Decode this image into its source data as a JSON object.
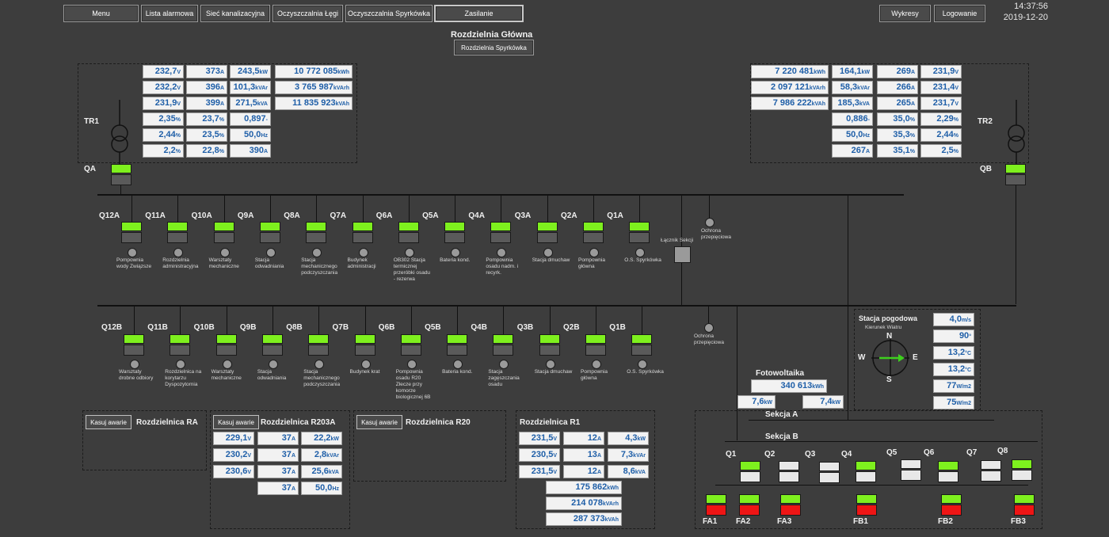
{
  "nav": {
    "menu": "Menu",
    "alarms": "Lista alarmowa",
    "sewer": "Sieć kanalizacyjna",
    "legi": "Oczyszczalnia Łęgi",
    "spyrkowka": "Oczyszczalnia Spyrkówka",
    "zasilanie": "Zasilanie",
    "wykresy": "Wykresy",
    "logowanie": "Logowanie"
  },
  "clock": {
    "time": "14:37:56",
    "date": "2019-12-20"
  },
  "page": {
    "title": "Rozdzielnia Główna",
    "subtitle_button": "Rozdzielnia Spyrkówka"
  },
  "tr1": {
    "label": "TR1",
    "breaker": "QA",
    "values": [
      [
        "232,7",
        "V"
      ],
      [
        "373",
        "A"
      ],
      [
        "243,5",
        "kW"
      ],
      [
        "10 772 085",
        "kWh"
      ],
      [
        "232,2",
        "V"
      ],
      [
        "396",
        "A"
      ],
      [
        "101,3",
        "kVAr"
      ],
      [
        "3 765 987",
        "kVArh"
      ],
      [
        "231,9",
        "V"
      ],
      [
        "399",
        "A"
      ],
      [
        "271,5",
        "kVA"
      ],
      [
        "11 835 923",
        "kVAh"
      ],
      [
        "2,35",
        "%"
      ],
      [
        "23,7",
        "%"
      ],
      [
        "0,897",
        "-"
      ],
      [
        "2,44",
        "%"
      ],
      [
        "23,5",
        "%"
      ],
      [
        "50,0",
        "Hz"
      ],
      [
        "2,2",
        "%"
      ],
      [
        "22,8",
        "%"
      ],
      [
        "390",
        "A"
      ]
    ]
  },
  "tr2": {
    "label": "TR2",
    "breaker": "QB",
    "values": [
      [
        "7 220 481",
        "kWh"
      ],
      [
        "164,1",
        "kW"
      ],
      [
        "269",
        "A"
      ],
      [
        "231,9",
        "V"
      ],
      [
        "2 097 121",
        "kVArh"
      ],
      [
        "58,3",
        "kVAr"
      ],
      [
        "266",
        "A"
      ],
      [
        "231,4",
        "V"
      ],
      [
        "7 986 222",
        "kVAh"
      ],
      [
        "185,3",
        "kVA"
      ],
      [
        "265",
        "A"
      ],
      [
        "231,7",
        "V"
      ],
      [
        "0,886",
        "-"
      ],
      [
        "35,0",
        "%"
      ],
      [
        "2,29",
        "%"
      ],
      [
        "50,0",
        "Hz"
      ],
      [
        "35,3",
        "%"
      ],
      [
        "2,44",
        "%"
      ],
      [
        "267",
        "A"
      ],
      [
        "35,1",
        "%"
      ],
      [
        "2,5",
        "%"
      ]
    ]
  },
  "busA": {
    "feeders": [
      {
        "id": "Q12A",
        "desc": "Pompownia wody Związsze"
      },
      {
        "id": "Q11A",
        "desc": "Rozdzielnia administracyjna"
      },
      {
        "id": "Q10A",
        "desc": "Warsztaty mechaniczne"
      },
      {
        "id": "Q9A",
        "desc": "Stacja odwadniania"
      },
      {
        "id": "Q8A",
        "desc": "Stacja mechanicznego podczyszczania"
      },
      {
        "id": "Q7A",
        "desc": "Budynek administracji"
      },
      {
        "id": "Q6A",
        "desc": "OB302 Stacja termicznej przeróbki osadu - rezerwa"
      },
      {
        "id": "Q5A",
        "desc": "Bateria kond."
      },
      {
        "id": "Q4A",
        "desc": "Pompownia osadu nadm. i recyrk."
      },
      {
        "id": "Q3A",
        "desc": "Stacja dmuchaw"
      },
      {
        "id": "Q2A",
        "desc": "Pompownia główna"
      },
      {
        "id": "Q1A",
        "desc": "O.S. Spyrkówka"
      }
    ],
    "coupler": "Łącznik Sekcji",
    "surge": "Ochrona przepięciowa"
  },
  "busB": {
    "feeders": [
      {
        "id": "Q12B",
        "desc": "Warsztaty drobne odbiory"
      },
      {
        "id": "Q11B",
        "desc": "Rozdzielnica na korytarzu Dyspozytornia"
      },
      {
        "id": "Q10B",
        "desc": "Warsztaty mechaniczne"
      },
      {
        "id": "Q9B",
        "desc": "Stacja odwadniania"
      },
      {
        "id": "Q8B",
        "desc": "Stacja mechanicznego podczyszczania"
      },
      {
        "id": "Q7B",
        "desc": "Budynek krat"
      },
      {
        "id": "Q6B",
        "desc": "Pompownia osadu R20 Złecze przy komorze biologicznej 6B"
      },
      {
        "id": "Q5B",
        "desc": "Bateria kond."
      },
      {
        "id": "Q4B",
        "desc": "Stacja zagęszczania osadu"
      },
      {
        "id": "Q3B",
        "desc": "Stacja dmuchaw"
      },
      {
        "id": "Q2B",
        "desc": "Pompownia główna"
      },
      {
        "id": "Q1B",
        "desc": "O.S. Spyrkówka"
      }
    ],
    "surge": "Ochrona przepięciowa"
  },
  "weather": {
    "title": "Stacja pogodowa",
    "wind_label": "Kierunek Wiatru",
    "compass": {
      "n": "N",
      "e": "E",
      "s": "S",
      "w": "W"
    },
    "values": [
      [
        "4,0",
        "m/s"
      ],
      [
        "90",
        "°"
      ],
      [
        "13,2",
        "°C"
      ],
      [
        "13,2",
        "°C"
      ],
      [
        "77",
        "W/m2"
      ],
      [
        "75",
        "W/m2"
      ]
    ]
  },
  "pv": {
    "title": "Fotowoltaika",
    "total": [
      "340 613",
      "kWh"
    ],
    "p1": [
      "7,6",
      "kW"
    ],
    "p2": [
      "7,4",
      "kW"
    ]
  },
  "ra": {
    "title": "Rozdzielnica RA",
    "reset": "Kasuj awarie"
  },
  "r203a": {
    "title": "Rozdzielnica R203A",
    "reset": "Kasuj awarie",
    "values": [
      [
        "229,1",
        "V"
      ],
      [
        "37",
        "A"
      ],
      [
        "22,2",
        "kW"
      ],
      [
        "230,2",
        "V"
      ],
      [
        "37",
        "A"
      ],
      [
        "2,8",
        "kVAr"
      ],
      [
        "230,6",
        "V"
      ],
      [
        "37",
        "A"
      ],
      [
        "25,6",
        "kVA"
      ],
      [
        "37",
        "A"
      ],
      [
        "50,0",
        "Hz"
      ]
    ]
  },
  "r20": {
    "title": "Rozdzielnica R20",
    "reset": "Kasuj awarie"
  },
  "r1": {
    "title": "Rozdzielnica R1",
    "values": [
      [
        "231,5",
        "V"
      ],
      [
        "12",
        "A"
      ],
      [
        "4,3",
        "kW"
      ],
      [
        "230,5",
        "V"
      ],
      [
        "13",
        "A"
      ],
      [
        "7,3",
        "kVAr"
      ],
      [
        "231,5",
        "V"
      ],
      [
        "12",
        "A"
      ],
      [
        "8,6",
        "kVA"
      ],
      [
        "175 862",
        "kWh"
      ],
      [
        "214 078",
        "kVArh"
      ],
      [
        "287 373",
        "kVAh"
      ]
    ]
  },
  "sections": {
    "a": "Sekcja A",
    "b": "Sekcja B",
    "q": [
      "Q1",
      "Q2",
      "Q3",
      "Q4",
      "Q5",
      "Q6",
      "Q7",
      "Q8"
    ],
    "fa": [
      "FA1",
      "FA2",
      "FA3",
      "FB1",
      "FB2",
      "FB3"
    ]
  }
}
